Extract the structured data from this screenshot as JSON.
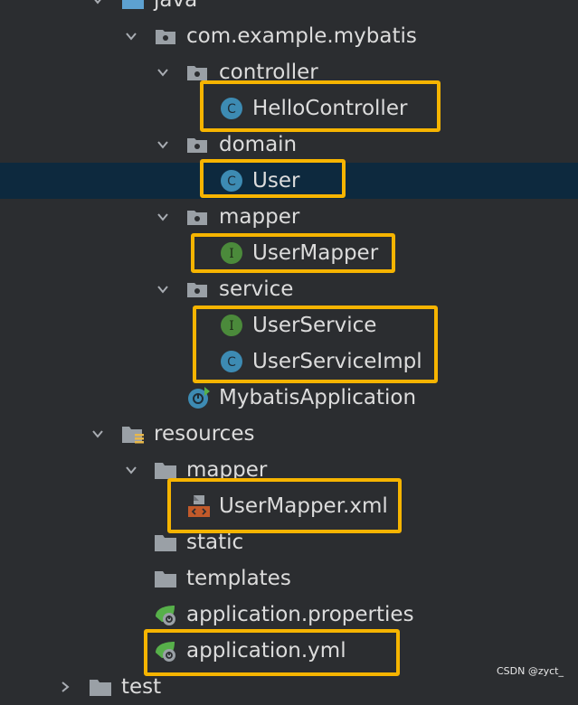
{
  "tree": {
    "java_label": "java",
    "package_label": "com.example.mybatis",
    "controller_label": "controller",
    "hello_controller_label": "HelloController",
    "domain_label": "domain",
    "user_label": "User",
    "mapper_label": "mapper",
    "user_mapper_label": "UserMapper",
    "service_label": "service",
    "user_service_label": "UserService",
    "user_service_impl_label": "UserServiceImpl",
    "app_class_label": "MybatisApplication",
    "resources_label": "resources",
    "res_mapper_label": "mapper",
    "user_mapper_xml_label": "UserMapper.xml",
    "static_label": "static",
    "templates_label": "templates",
    "app_properties_label": "application.properties",
    "app_yml_label": "application.yml",
    "test_label": "test"
  },
  "watermark": "CSDN @zyct_",
  "colors": {
    "background": "#2b2d30",
    "selected_row": "#0d293e",
    "highlight_box": "#f6b400",
    "class_icon": "#3d8bb3",
    "interface_icon": "#4b8a3b",
    "folder": "#9aa0a6"
  },
  "icons": [
    "chevron-down-icon",
    "chevron-right-icon",
    "package-icon",
    "folder-icon",
    "resources-folder-icon",
    "class-icon",
    "interface-icon",
    "spring-boot-app-icon",
    "xml-file-icon",
    "spring-config-icon"
  ]
}
